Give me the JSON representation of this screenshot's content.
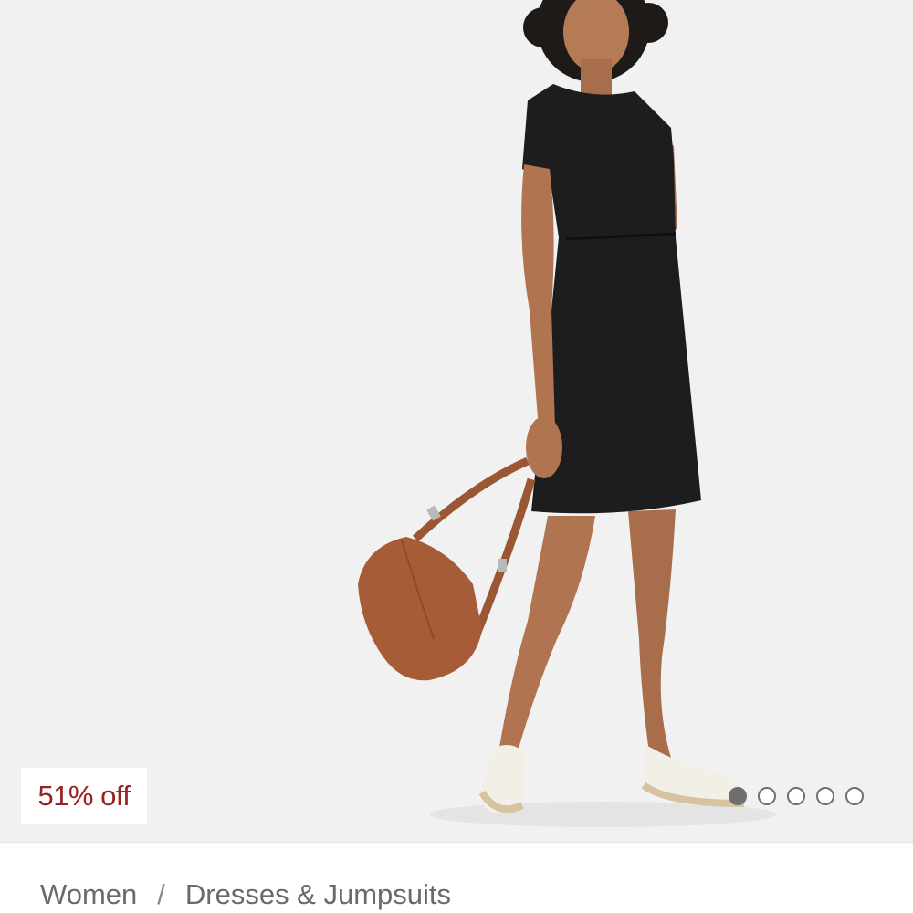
{
  "product_image": {
    "alt": "",
    "discount_badge": "51% off",
    "carousel": {
      "total": 5,
      "active_index": 0
    }
  },
  "breadcrumb": {
    "items": [
      "Women",
      "Dresses & Jumpsuits"
    ],
    "separator": "/"
  },
  "colors": {
    "badge_text": "#9a2121",
    "background": "#f1f1f1",
    "dot": "#6f6f6f"
  }
}
